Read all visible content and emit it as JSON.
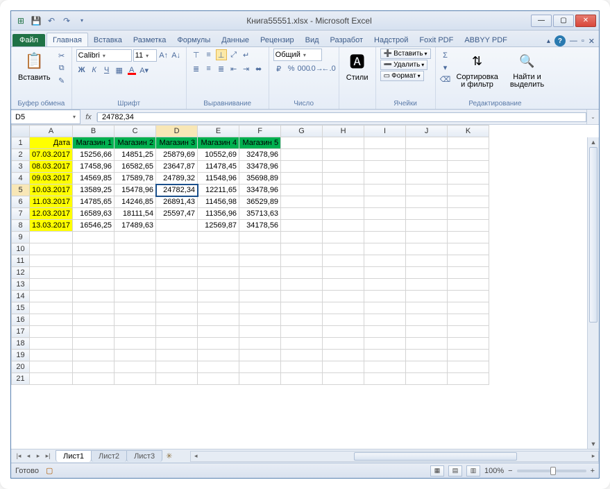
{
  "title": "Книга55551.xlsx - Microsoft Excel",
  "qat": {
    "save": "💾",
    "undo": "↶",
    "redo": "↷"
  },
  "tabs": {
    "file": "Файл",
    "items": [
      "Главная",
      "Вставка",
      "Разметка",
      "Формулы",
      "Данные",
      "Рецензир",
      "Вид",
      "Разработ",
      "Надстрой",
      "Foxit PDF",
      "ABBYY PDF"
    ],
    "active": 0
  },
  "ribbon": {
    "clipboard": {
      "paste": "Вставить",
      "label": "Буфер обмена"
    },
    "font": {
      "name": "Calibri",
      "size": "11",
      "label": "Шрифт",
      "bold": "Ж",
      "italic": "К",
      "underline": "Ч"
    },
    "align": {
      "label": "Выравнивание"
    },
    "number": {
      "format": "Общий",
      "label": "Число"
    },
    "styles": {
      "btn": "Стили",
      "label": ""
    },
    "cells": {
      "insert": "Вставить",
      "delete": "Удалить",
      "format": "Формат",
      "label": "Ячейки"
    },
    "editing": {
      "sort": "Сортировка и фильтр",
      "find": "Найти и выделить",
      "label": "Редактирование"
    }
  },
  "namebox": "D5",
  "formula": "24782,34",
  "columns": [
    "A",
    "B",
    "C",
    "D",
    "E",
    "F",
    "G",
    "H",
    "I",
    "J",
    "K"
  ],
  "selected_col": "D",
  "selected_row": 5,
  "rows": [
    1,
    2,
    3,
    4,
    5,
    6,
    7,
    8,
    9,
    10,
    11,
    12,
    13,
    14,
    15,
    16,
    17,
    18,
    19,
    20,
    21
  ],
  "data": {
    "header": [
      "Дата",
      "Магазин 1",
      "Магазин 2",
      "Магазин 3",
      "Магазин 4",
      "Магазин 5"
    ],
    "body": [
      [
        "07.03.2017",
        "15256,66",
        "14851,25",
        "25879,69",
        "10552,69",
        "32478,96"
      ],
      [
        "08.03.2017",
        "17458,96",
        "16582,65",
        "23647,87",
        "11478,45",
        "33478,96"
      ],
      [
        "09.03.2017",
        "14569,85",
        "17589,78",
        "24789,32",
        "11548,96",
        "35698,89"
      ],
      [
        "10.03.2017",
        "13589,25",
        "15478,96",
        "24782,34",
        "12211,65",
        "33478,96"
      ],
      [
        "11.03.2017",
        "14785,65",
        "14246,85",
        "26891,43",
        "11456,98",
        "36529,89"
      ],
      [
        "12.03.2017",
        "16589,63",
        "18111,54",
        "25597,47",
        "11356,96",
        "35713,63"
      ],
      [
        "13.03.2017",
        "16546,25",
        "17489,63",
        "",
        "12569,87",
        "34178,56"
      ]
    ]
  },
  "sheets": {
    "active": "Лист1",
    "others": [
      "Лист2",
      "Лист3"
    ]
  },
  "status": {
    "ready": "Готово",
    "zoom": "100%"
  }
}
